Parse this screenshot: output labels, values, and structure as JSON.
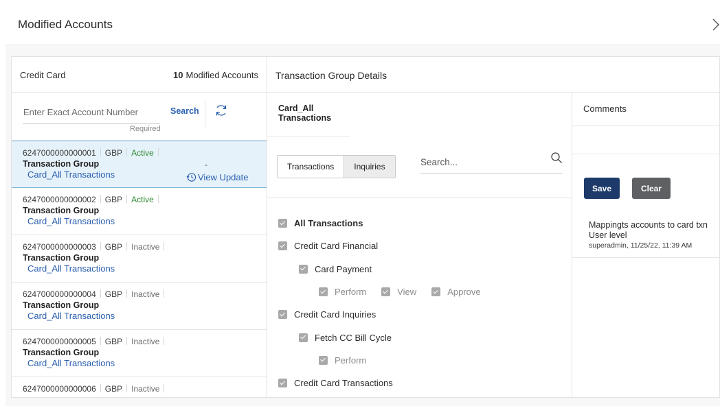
{
  "header": {
    "title": "Modified Accounts"
  },
  "left": {
    "product_label": "Credit Card",
    "modified_count": "10",
    "modified_label": "Modified Accounts",
    "search_placeholder": "Enter Exact Account Number",
    "required_label": "Required",
    "search_label": "Search",
    "accounts": [
      {
        "number": "6247000000000001",
        "currency": "GBP",
        "status": "Active",
        "group_label": "Transaction Group",
        "group": "Card_All Transactions",
        "dash": "-",
        "view_update": "View Update"
      },
      {
        "number": "6247000000000002",
        "currency": "GBP",
        "status": "Active",
        "group_label": "Transaction Group",
        "group": "Card_All Transactions"
      },
      {
        "number": "6247000000000003",
        "currency": "GBP",
        "status": "Inactive",
        "group_label": "Transaction Group",
        "group": "Card_All Transactions"
      },
      {
        "number": "6247000000000004",
        "currency": "GBP",
        "status": "Inactive",
        "group_label": "Transaction Group",
        "group": "Card_All Transactions"
      },
      {
        "number": "6247000000000005",
        "currency": "GBP",
        "status": "Inactive",
        "group_label": "Transaction Group",
        "group": "Card_All Transactions"
      },
      {
        "number": "6247000000000006",
        "currency": "GBP",
        "status": "Inactive"
      }
    ]
  },
  "details": {
    "title": "Transaction Group Details",
    "group_name": "Card_All Transactions",
    "tabs": [
      "Transactions",
      "Inquiries"
    ],
    "search_placeholder": "Search...",
    "tree": {
      "all": "All Transactions",
      "financial": "Credit Card Financial",
      "card_payment": "Card Payment",
      "perm_perform": "Perform",
      "perm_view": "View",
      "perm_approve": "Approve",
      "inquiries": "Credit Card Inquiries",
      "bill_cycle": "Fetch CC Bill Cycle",
      "transactions": "Credit Card Transactions"
    }
  },
  "comments": {
    "title": "Comments",
    "save_label": "Save",
    "clear_label": "Clear",
    "entry_text": "Mappingts accounts to card txn User level",
    "entry_meta": "superadmin, 11/25/22, 11:39 AM"
  },
  "colors": {
    "link": "#2a5fb0",
    "active_status": "#2f8a2f",
    "save_button": "#1d3a6b",
    "clear_button": "#5e6064",
    "selected_row": "#e6f2fa"
  }
}
